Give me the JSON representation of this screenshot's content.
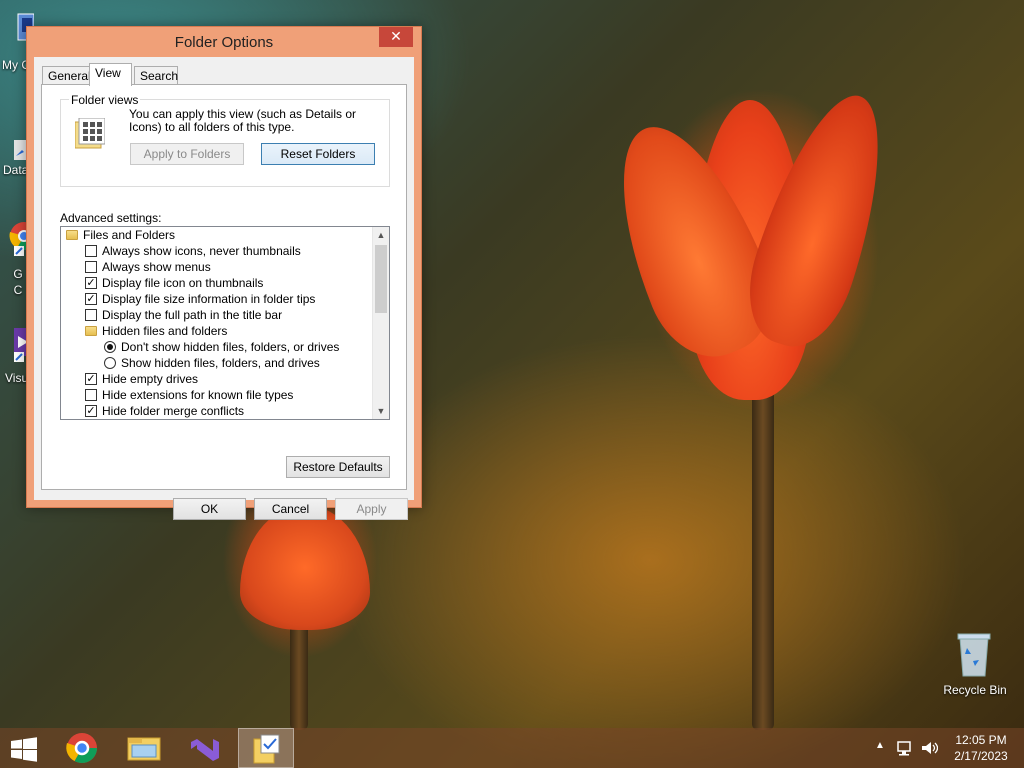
{
  "dialog": {
    "title": "Folder Options",
    "close_glyph": "✕",
    "tabs": [
      "General",
      "View",
      "Search"
    ],
    "folder_views": {
      "label": "Folder views",
      "description": "You can apply this view (such as Details or Icons) to all folders of this type.",
      "apply_button": "Apply to Folders",
      "reset_button": "Reset Folders"
    },
    "advanced_label": "Advanced settings:",
    "tree": [
      {
        "type": "folder",
        "label": "Files and Folders"
      },
      {
        "type": "checkbox",
        "checked": false,
        "label": "Always show icons, never thumbnails"
      },
      {
        "type": "checkbox",
        "checked": false,
        "label": "Always show menus"
      },
      {
        "type": "checkbox",
        "checked": true,
        "label": "Display file icon on thumbnails"
      },
      {
        "type": "checkbox",
        "checked": true,
        "label": "Display file size information in folder tips"
      },
      {
        "type": "checkbox",
        "checked": false,
        "label": "Display the full path in the title bar"
      },
      {
        "type": "folder",
        "label": "Hidden files and folders"
      },
      {
        "type": "radio",
        "checked": true,
        "label": "Don't show hidden files, folders, or drives"
      },
      {
        "type": "radio",
        "checked": false,
        "label": "Show hidden files, folders, and drives"
      },
      {
        "type": "checkbox",
        "checked": true,
        "label": "Hide empty drives"
      },
      {
        "type": "checkbox",
        "checked": false,
        "label": "Hide extensions for known file types"
      },
      {
        "type": "checkbox",
        "checked": true,
        "label": "Hide folder merge conflicts"
      }
    ],
    "restore_button": "Restore Defaults",
    "ok_button": "OK",
    "cancel_button": "Cancel",
    "apply_button": "Apply"
  },
  "desktop": {
    "icons": [
      {
        "label": "My C"
      },
      {
        "label": "Data"
      },
      {
        "label": "G\nC"
      },
      {
        "label": "Visu"
      }
    ],
    "recycle_bin": "Recycle Bin"
  },
  "taskbar": {
    "time": "12:05 PM",
    "date": "2/17/2023"
  },
  "colors": {
    "accent": "#f0a078",
    "close": "#c7473a"
  }
}
